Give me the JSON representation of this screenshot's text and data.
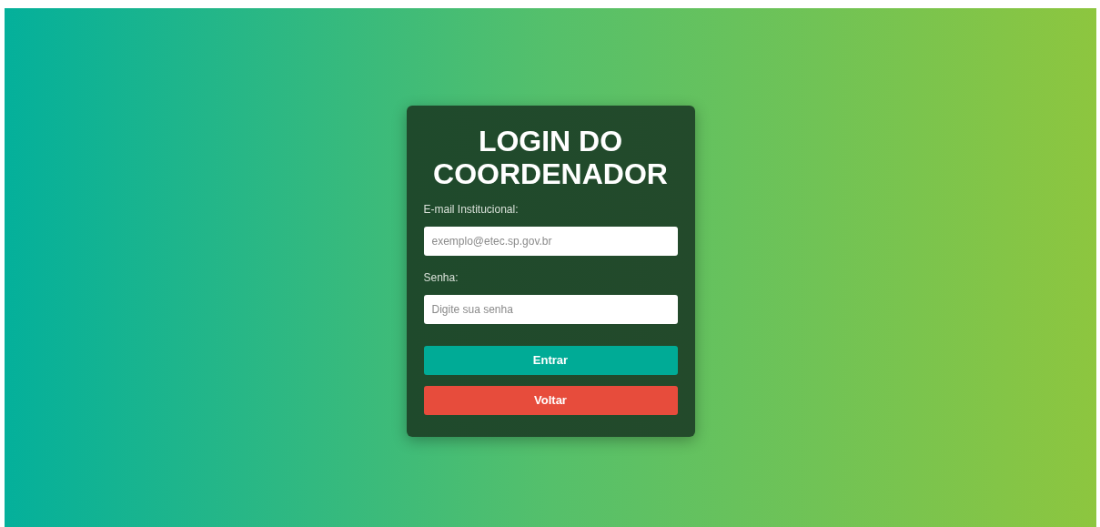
{
  "title": "LOGIN DO COORDENADOR",
  "fields": [
    {
      "label": "E-mail Institucional:",
      "placeholder": "exemplo@etec.sp.gov.br"
    },
    {
      "label": "Senha:",
      "placeholder": "Digite sua senha"
    }
  ],
  "buttons": [
    {
      "label": "Entrar",
      "kind": "primary"
    },
    {
      "label": "Voltar",
      "kind": "danger"
    }
  ]
}
